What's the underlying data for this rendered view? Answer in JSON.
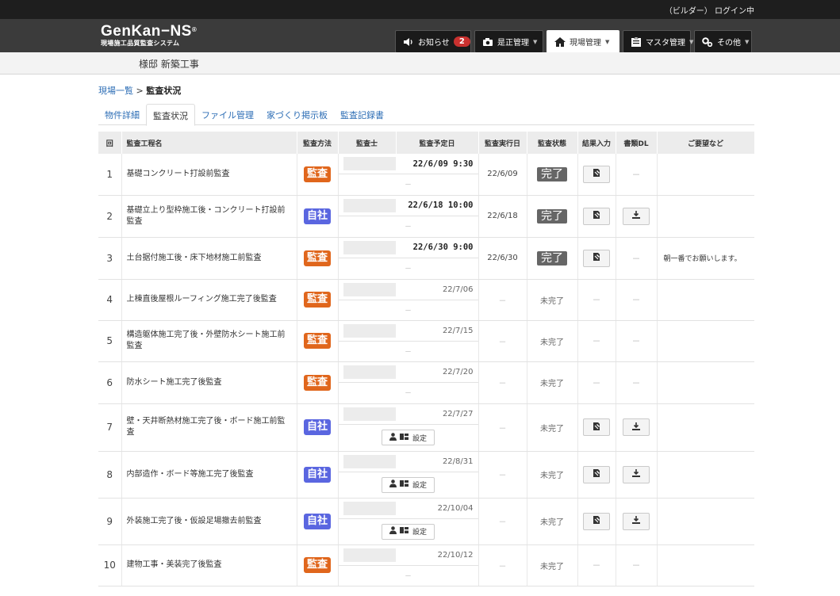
{
  "topbar": {
    "login_status": "（ビルダー） ログイン中"
  },
  "header": {
    "logo_name": "GenKan−NS",
    "logo_reg": "®",
    "logo_sub": "現場施工品質監査システム"
  },
  "nav": {
    "notice_label": "お知らせ",
    "notice_count": "2",
    "correction_label": "是正管理",
    "site_label": "現場管理",
    "master_label": "マスタ管理",
    "other_label": "その他"
  },
  "site_name": "様邸 新築工事",
  "breadcrumb": {
    "link": "現場一覧",
    "separator": ">",
    "current": "監査状況"
  },
  "tabs": [
    "物件詳細",
    "監査状況",
    "ファイル管理",
    "家づくり掲示板",
    "監査記録書"
  ],
  "table": {
    "headers": [
      "回",
      "監査工程名",
      "監査方法",
      "監査士",
      "監査予定日",
      "監査実行日",
      "監査状態",
      "結果入力",
      "書類DL",
      "ご要望など"
    ],
    "set_label": "設定",
    "dash": "－",
    "rows": [
      {
        "num": "1",
        "name": "基礎コンクリート打設前監査",
        "method": "監査",
        "planned": "22/6/09  9:30",
        "executed": "22/6/09",
        "status": "完了",
        "note": ""
      },
      {
        "num": "2",
        "name": "基礎立上り型枠施工後・コンクリート打設前監査",
        "method": "自社",
        "planned": "22/6/18  10:00",
        "executed": "22/6/18",
        "status": "完了",
        "note": ""
      },
      {
        "num": "3",
        "name": "土台据付施工後・床下地材施工前監査",
        "method": "監査",
        "planned": "22/6/30  9:00",
        "executed": "22/6/30",
        "status": "完了",
        "note": "朝一番でお願いします。"
      },
      {
        "num": "4",
        "name": "上棟直後屋根ルーフィング施工完了後監査",
        "method": "監査",
        "planned": "22/7/06",
        "executed": "－",
        "status": "未完了",
        "note": ""
      },
      {
        "num": "5",
        "name": "構造躯体施工完了後・外壁防水シート施工前監査",
        "method": "監査",
        "planned": "22/7/15",
        "executed": "－",
        "status": "未完了",
        "note": ""
      },
      {
        "num": "6",
        "name": "防水シート施工完了後監査",
        "method": "監査",
        "planned": "22/7/20",
        "executed": "－",
        "status": "未完了",
        "note": ""
      },
      {
        "num": "7",
        "name": "壁・天井断熱材施工完了後・ボード施工前監査",
        "method": "自社",
        "planned": "22/7/27",
        "executed": "－",
        "status": "未完了",
        "note": ""
      },
      {
        "num": "8",
        "name": "内部造作・ボード等施工完了後監査",
        "method": "自社",
        "planned": "22/8/31",
        "executed": "－",
        "status": "未完了",
        "note": ""
      },
      {
        "num": "9",
        "name": "外装施工完了後・仮設足場撤去前監査",
        "method": "自社",
        "planned": "22/10/04",
        "executed": "－",
        "status": "未完了",
        "note": ""
      },
      {
        "num": "10",
        "name": "建物工事・美装完了後監査",
        "method": "監査",
        "planned": "22/10/12",
        "executed": "－",
        "status": "未完了",
        "note": ""
      }
    ]
  }
}
